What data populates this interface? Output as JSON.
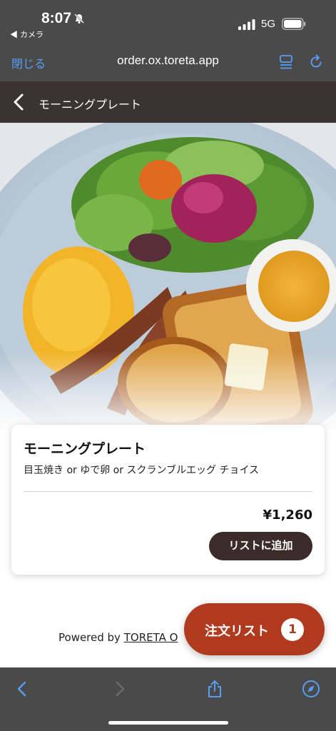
{
  "status_bar": {
    "time": "8:07",
    "back_app": "◀ カメラ",
    "network": "5G"
  },
  "browser": {
    "close_label": "閉じる",
    "url": "order.ox.toreta.app"
  },
  "header": {
    "title": "モーニングプレート"
  },
  "product": {
    "name": "モーニングプレート",
    "description": "目玉焼き or ゆで卵 or スクランブルエッグ チョイス",
    "price": "¥1,260",
    "add_button_label": "リストに追加"
  },
  "footer": {
    "powered_prefix": "Powered by ",
    "powered_link": "TORETA O"
  },
  "order_list": {
    "label": "注文リスト",
    "count": "1"
  },
  "colors": {
    "header_bg": "#3b3232",
    "add_button_bg": "#3b2c2a",
    "order_button_bg": "#b03a1d",
    "browser_chrome": "#4a4a4a",
    "link_blue": "#5a9df5"
  },
  "icons": [
    "mute-icon",
    "signal-icon",
    "battery-icon",
    "menu-icon",
    "reload-icon",
    "chevron-left-icon",
    "back-icon",
    "forward-icon",
    "share-icon",
    "compass-icon"
  ]
}
